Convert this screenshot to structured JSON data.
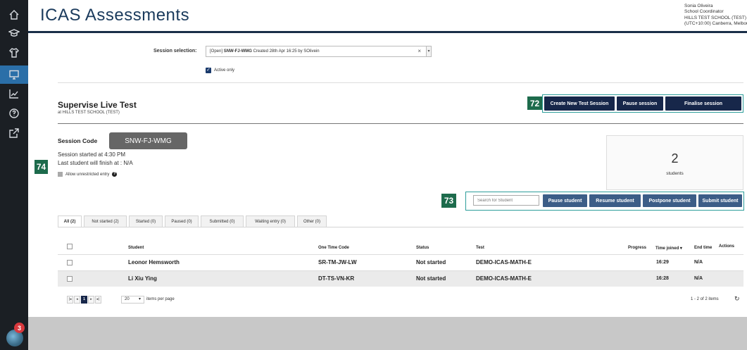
{
  "app": {
    "title": "ICAS Assessments",
    "user": {
      "name": "Sonia Oliveira",
      "role": "School Coordinator",
      "school": "HILLS TEST SCHOOL (TEST)",
      "timezone": "(UTC+10:00) Canberra, Melbourne, Sydney"
    },
    "notifications_count": "3"
  },
  "sidebar": {
    "items": [
      {
        "icon": "home-icon"
      },
      {
        "icon": "graduation-cap-icon"
      },
      {
        "icon": "shirt-icon"
      },
      {
        "icon": "monitor-icon",
        "active": true
      },
      {
        "icon": "line-chart-icon"
      },
      {
        "icon": "help-circle-icon"
      },
      {
        "icon": "external-link-icon"
      }
    ]
  },
  "session": {
    "label": "Session selection:",
    "selected_prefix": "[Open] ",
    "selected_code": "SNW-FJ-WMG",
    "selected_suffix": " Created 28th Apr 16:25 by SOlivein",
    "clear_symbol": "×",
    "active_only_label": "Active only",
    "active_only_checked": true
  },
  "supervise": {
    "title": "Supervise Live Test",
    "subtitle": "at HILLS TEST SCHOOL (TEST)",
    "buttons": {
      "create": "Create New Test Session",
      "pause": "Pause session",
      "finalise": "Finalise session"
    }
  },
  "markers": {
    "m72": "72",
    "m73": "73",
    "m74": "74"
  },
  "session_info": {
    "code_label": "Session Code",
    "code": "SNW-FJ-WMG",
    "started": "Session started at 4:30 PM",
    "last_finish": "Last student will finish at : N/A",
    "allow_unrestricted": "Allow unrestricted entry"
  },
  "stats": {
    "count": "2",
    "label": "students"
  },
  "student_actions": {
    "search_placeholder": "Search for Student",
    "pause": "Pause student",
    "resume": "Resume student",
    "postpone": "Postpone student",
    "submit": "Submit student"
  },
  "tabs": [
    {
      "label": "All (2)",
      "active": true
    },
    {
      "label": "Not started (2)"
    },
    {
      "label": "Started (0)"
    },
    {
      "label": "Paused (0)"
    },
    {
      "label": "Submitted (0)"
    },
    {
      "label": "Waiting entry (0)"
    },
    {
      "label": "Other (0)"
    }
  ],
  "table": {
    "headers": {
      "student": "Student",
      "code": "One Time Code",
      "status": "Status",
      "test": "Test",
      "progress": "Progress",
      "time_joined": "Time joined ▾",
      "end_time": "End time",
      "actions": "Actions"
    },
    "rows": [
      {
        "student": "Leonor Hemsworth",
        "code": "SR-TM-JW-LW",
        "status": "Not started",
        "test": "DEMO-ICAS-MATH-E",
        "time_joined": "16:29",
        "end_time": "N/A"
      },
      {
        "student": "Li Xiu Ying",
        "code": "DT-TS-VN-KR",
        "status": "Not started",
        "test": "DEMO-ICAS-MATH-E",
        "time_joined": "16:28",
        "end_time": "N/A"
      }
    ]
  },
  "pagination": {
    "first": "|◂",
    "prev": "◂",
    "current": "1",
    "next": "▸",
    "last": "▸|",
    "per_page": "20",
    "per_page_label": "items per page",
    "range": "1 - 2 of 2 items"
  },
  "colors": {
    "brand_dark": "#17274a",
    "button_mid": "#3c5d87",
    "marker": "#1d6b4c",
    "frame": "#2d9d9a",
    "rail": "#1b1f24",
    "badge": "#d8383d"
  }
}
